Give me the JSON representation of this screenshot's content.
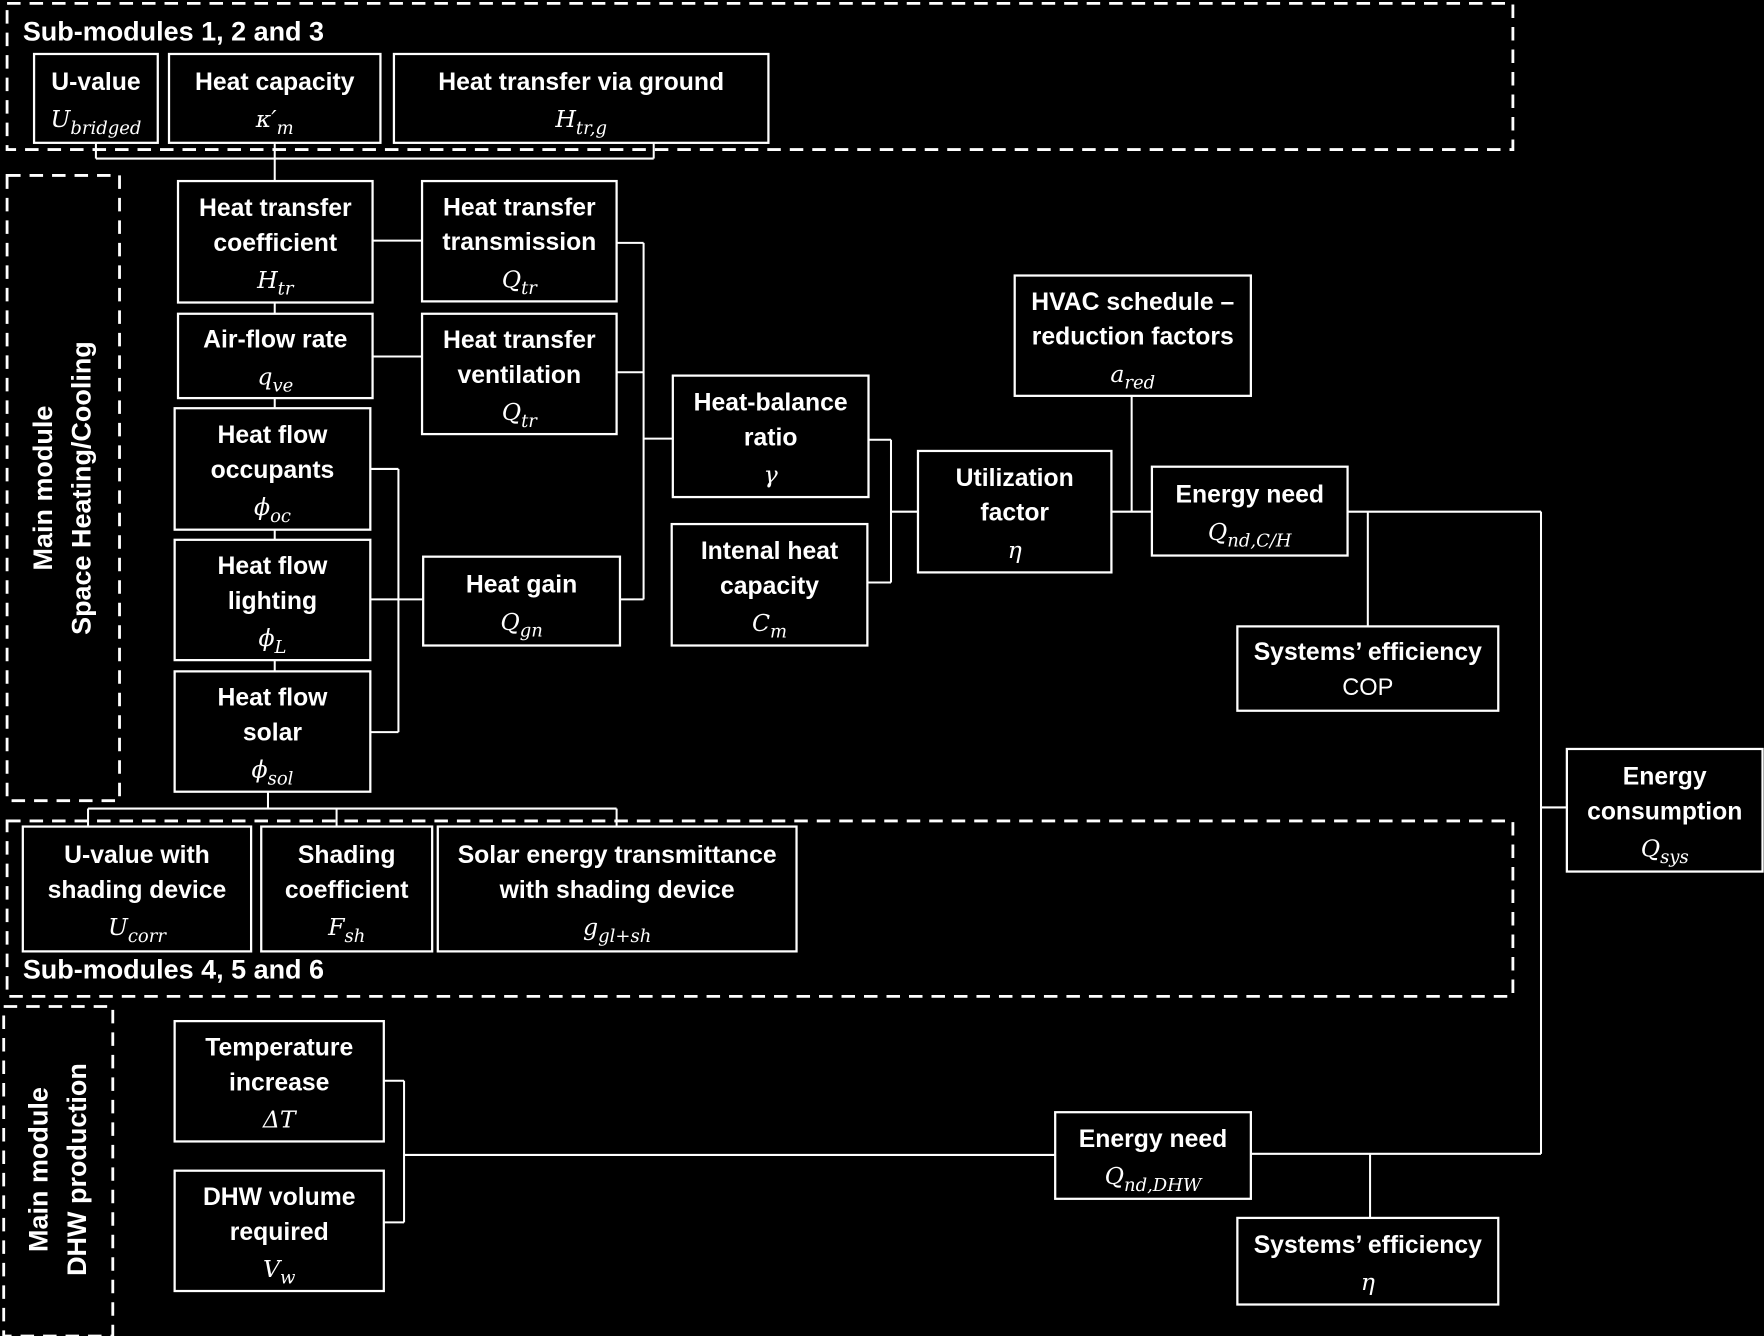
{
  "colors": {
    "background": "#000000",
    "foreground": "#ffffff"
  },
  "groups": [
    {
      "id": "sub123",
      "lines": [
        "Sub-modules 1, 2 and 3"
      ]
    },
    {
      "id": "main_sh",
      "lines": [
        "Main module",
        "Space Heating/Cooling"
      ]
    },
    {
      "id": "sub456",
      "lines": [
        "Sub-modules 4, 5 and 6"
      ]
    },
    {
      "id": "main_dhw",
      "lines": [
        "Main module",
        "DHW production"
      ]
    }
  ],
  "boxes": [
    {
      "id": "u-value",
      "lines": [
        "U-value"
      ],
      "sym": "U",
      "sub": "bridged"
    },
    {
      "id": "heat-capacity",
      "lines": [
        "Heat capacity"
      ],
      "sym": "κ′",
      "sub": "m"
    },
    {
      "id": "heat-transfer-ground",
      "lines": [
        "Heat transfer via ground"
      ],
      "sym": "H",
      "sub": "tr,g"
    },
    {
      "id": "heat-transfer-coefficient",
      "lines": [
        "Heat transfer",
        "coefficient"
      ],
      "sym": "H",
      "sub": "tr"
    },
    {
      "id": "heat-transfer-transmission",
      "lines": [
        "Heat transfer",
        "transmission"
      ],
      "sym": "Q",
      "sub": "tr"
    },
    {
      "id": "air-flow-rate",
      "lines": [
        "Air-flow rate"
      ],
      "sym": "q",
      "sub": "ve"
    },
    {
      "id": "heat-transfer-ventilation",
      "lines": [
        "Heat transfer",
        "ventilation"
      ],
      "sym": "Q",
      "sub": "tr"
    },
    {
      "id": "heat-flow-occupants",
      "lines": [
        "Heat flow",
        "occupants"
      ],
      "sym": "ϕ",
      "sub": "oc"
    },
    {
      "id": "heat-flow-lighting",
      "lines": [
        "Heat flow",
        "lighting"
      ],
      "sym": "ϕ",
      "sub": "L"
    },
    {
      "id": "heat-flow-solar",
      "lines": [
        "Heat flow",
        "solar"
      ],
      "sym": "ϕ",
      "sub": "sol"
    },
    {
      "id": "heat-gain",
      "lines": [
        "Heat gain"
      ],
      "sym": "Q",
      "sub": "gn"
    },
    {
      "id": "heat-balance-ratio",
      "lines": [
        "Heat-balance",
        "ratio"
      ],
      "sym": "γ",
      "sub": ""
    },
    {
      "id": "internal-heat-capacity",
      "lines": [
        "Intenal heat",
        "capacity"
      ],
      "sym": "C",
      "sub": "m"
    },
    {
      "id": "utilization-factor",
      "lines": [
        "Utilization",
        "factor"
      ],
      "sym": "η",
      "sub": ""
    },
    {
      "id": "hvac-schedule",
      "lines": [
        "HVAC schedule –",
        "reduction factors"
      ],
      "sym": "a",
      "sub": "red"
    },
    {
      "id": "energy-need-ch",
      "lines": [
        "Energy need"
      ],
      "sym": "Q",
      "sub": "nd,C/H"
    },
    {
      "id": "systems-efficiency-cop",
      "lines": [
        "Systems’ efficiency"
      ],
      "sym": "COP",
      "sub": "",
      "plain": true
    },
    {
      "id": "energy-consumption",
      "lines": [
        "Energy",
        "consumption"
      ],
      "sym": "Q",
      "sub": "sys"
    },
    {
      "id": "u-value-shading",
      "lines": [
        "U-value with",
        "shading device"
      ],
      "sym": "U",
      "sub": "corr"
    },
    {
      "id": "shading-coefficient",
      "lines": [
        "Shading",
        "coefficient"
      ],
      "sym": "F",
      "sub": "sh"
    },
    {
      "id": "solar-energy-transmittance",
      "lines": [
        "Solar energy transmittance",
        "with shading device"
      ],
      "sym": "g",
      "sub": "gl+sh"
    },
    {
      "id": "temperature-increase",
      "lines": [
        "Temperature",
        "increase"
      ],
      "sym": "ΔT",
      "sub": ""
    },
    {
      "id": "dhw-volume",
      "lines": [
        "DHW volume",
        "required"
      ],
      "sym": "V",
      "sub": "w"
    },
    {
      "id": "energy-need-dhw",
      "lines": [
        "Energy need"
      ],
      "sym": "Q",
      "sub": "nd,DHW"
    },
    {
      "id": "systems-efficiency-dhw",
      "lines": [
        "Systems’ efficiency"
      ],
      "sym": "η",
      "sub": ""
    }
  ]
}
